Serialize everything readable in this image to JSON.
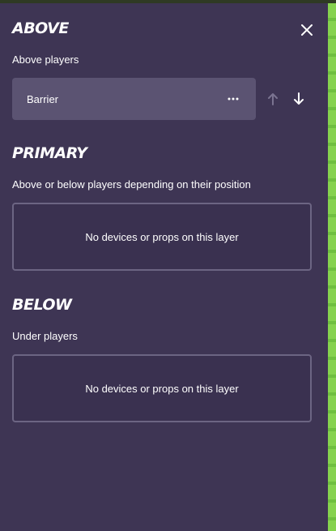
{
  "panel": {
    "close_icon": "close-icon",
    "sections": [
      {
        "title": "ABOVE",
        "description": "Above players",
        "items": [
          {
            "label": "Barrier",
            "more_icon": "more-horizontal-icon"
          }
        ],
        "move_up_icon": "arrow-up-icon",
        "move_down_icon": "arrow-down-icon"
      },
      {
        "title": "PRIMARY",
        "description": "Above or below players depending on their position",
        "empty_text": "No devices or props on this layer"
      },
      {
        "title": "BELOW",
        "description": "Under players",
        "empty_text": "No devices or props on this layer"
      }
    ]
  },
  "colors": {
    "panel_bg": "#3e3554",
    "card_bg": "#5b5372",
    "empty_border": "#6c6583",
    "grass": "#7bc44a"
  }
}
